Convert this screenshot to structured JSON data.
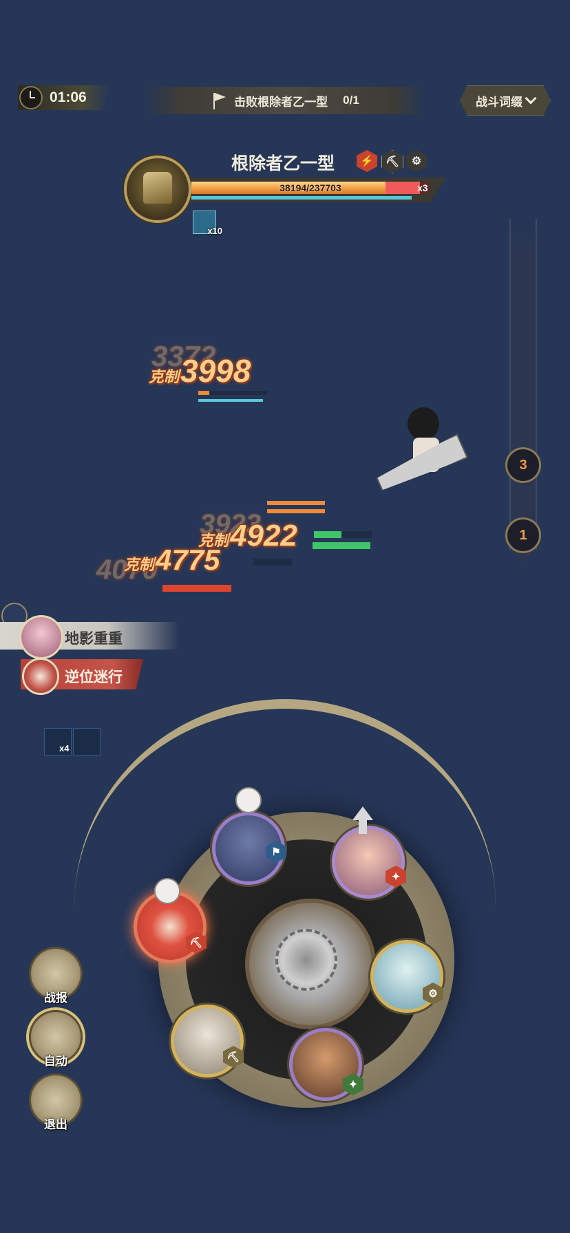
{
  "hud": {
    "timer": "01:06",
    "objective": {
      "text": "击败根除者乙一型",
      "count": "0/1"
    },
    "battle_terms_label": "战斗词缀"
  },
  "boss": {
    "name": "根除者乙一型",
    "hp_text": "38194/237703",
    "hp_current": 38194,
    "hp_max": 237703,
    "bars_multiplier": "x3",
    "buff_stack": "x10",
    "traits": [
      "trait-burst-icon",
      "trait-pick-icon",
      "trait-gear-icon"
    ]
  },
  "waves": {
    "nodes": [
      "3",
      "1"
    ]
  },
  "damage_numbers": [
    {
      "tag": "克制",
      "value": "3998"
    },
    {
      "tag": "克制",
      "value": "4922"
    },
    {
      "tag": "克制",
      "value": "4775"
    }
  ],
  "ghost_numbers": [
    "3372",
    "3923",
    "4070"
  ],
  "skills": {
    "notice_1": "地影重重",
    "notice_2": "逆位迷行",
    "stack_count": "x4"
  },
  "buttons": {
    "report": "战报",
    "auto": "自动",
    "exit": "退出"
  },
  "colors": {
    "background": "#263657",
    "hp_fill": "#f3a24a",
    "hp_loss": "#f05a5a",
    "shield": "#59c7d6",
    "damage_text": "#f8cf8c"
  }
}
